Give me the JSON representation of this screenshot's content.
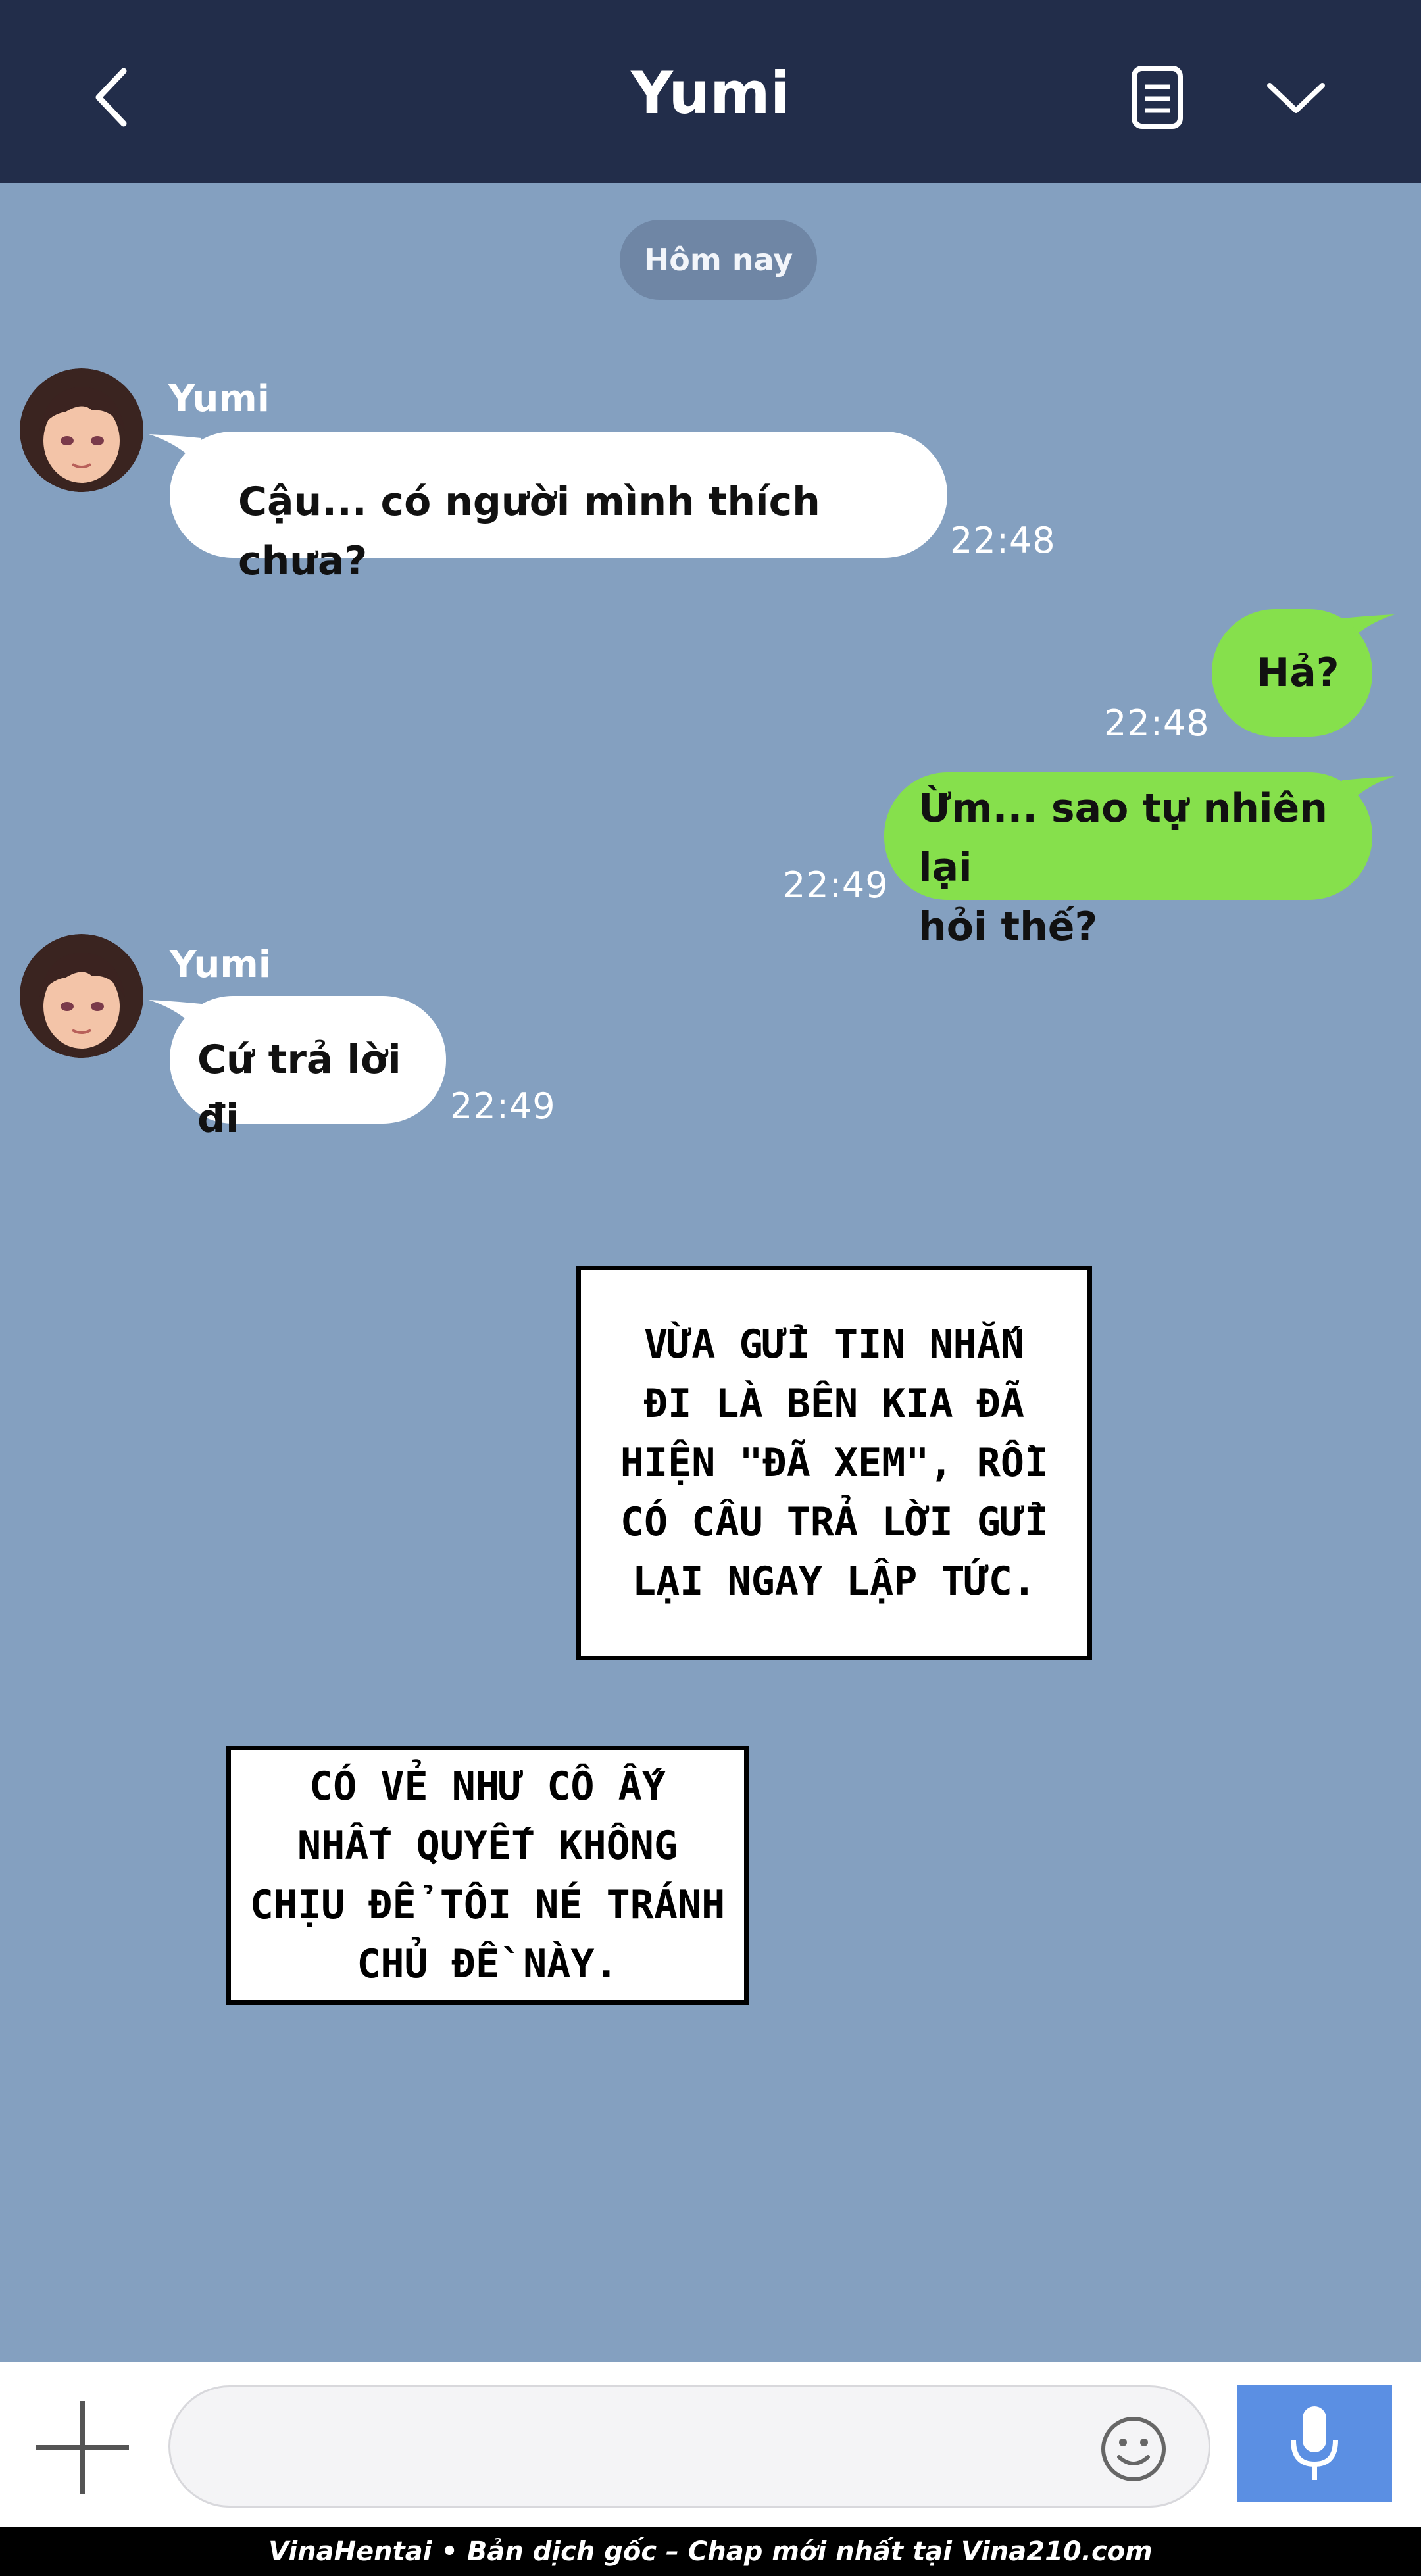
{
  "header": {
    "title": "Yumi",
    "back_icon": "chevron-left-icon",
    "notes_icon": "document-icon",
    "menu_icon": "chevron-down-icon"
  },
  "date_separator": "Hôm nay",
  "messages": [
    {
      "direction": "in",
      "sender": "Yumi",
      "text": "Cậu... có người mình thích chưa?",
      "time": "22:48"
    },
    {
      "direction": "out",
      "text": "Hả?",
      "time": "22:48"
    },
    {
      "direction": "out",
      "lines": [
        "Ừm... sao tự nhiên lại",
        "hỏi thế?"
      ],
      "time": "22:49"
    },
    {
      "direction": "in",
      "sender": "Yumi",
      "text": "Cứ trả lời đi",
      "time": "22:49"
    }
  ],
  "captions": [
    {
      "lines": [
        "VỪA GỬI TIN NHẮN",
        "ĐI LÀ BÊN KIA ĐÃ",
        "HIỆN \"ĐÃ XEM\", RỒI",
        "CÓ CÂU TRẢ LỜI GỬI",
        "LẠI NGAY LẬP TỨC."
      ]
    },
    {
      "lines": [
        "CÓ VẺ NHƯ CÔ ẤY",
        "NHẤT QUYẾT KHÔNG",
        "CHỊU ĐỂ TÔI NÉ TRÁNH",
        "CHỦ ĐỀ NÀY."
      ]
    }
  ],
  "composer": {
    "plus_icon": "plus-icon",
    "emoji_icon": "smiley-icon",
    "mic_icon": "microphone-icon"
  },
  "footer": "VinaHentai • Bản dịch gốc – Chap mới nhất tại Vina210.com",
  "colors": {
    "background": "#84a0c0",
    "header": "#222d4a",
    "incoming_bubble": "#ffffff",
    "outgoing_bubble": "#86e04c",
    "mic_button": "#5b8fe3"
  }
}
